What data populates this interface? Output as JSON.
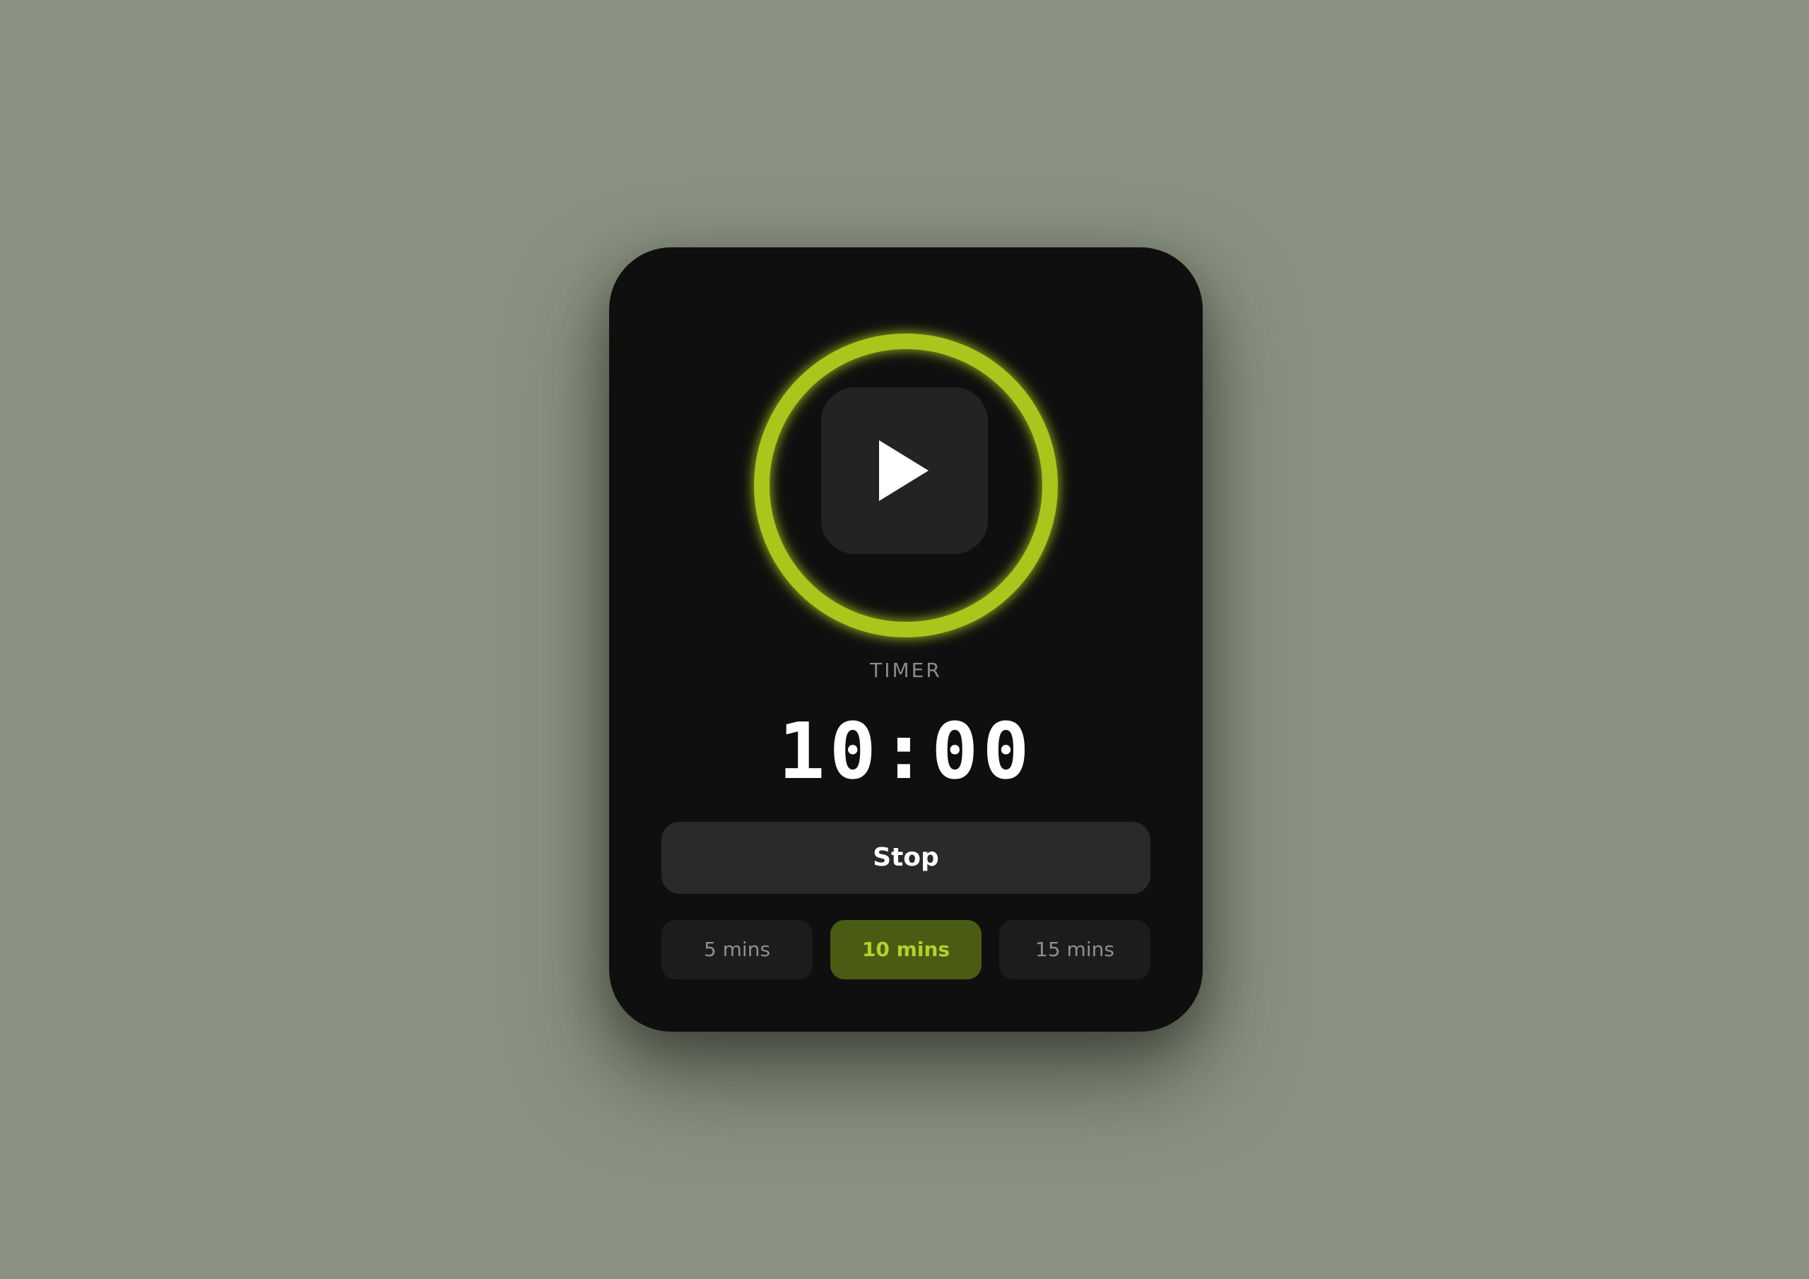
{
  "timer": {
    "label": "TIMER",
    "time": "10:00",
    "stop_label": "Stop",
    "play_icon": "play-icon",
    "presets": [
      {
        "label": "5 mins",
        "active": false
      },
      {
        "label": "10 mins",
        "active": true
      },
      {
        "label": "15 mins",
        "active": false
      }
    ]
  },
  "colors": {
    "background": "#8a9180",
    "card": "#0f0f0f",
    "accent": "#a8c61e",
    "active_preset_bg": "#4a5c14",
    "active_preset_text": "#b4d12a"
  }
}
